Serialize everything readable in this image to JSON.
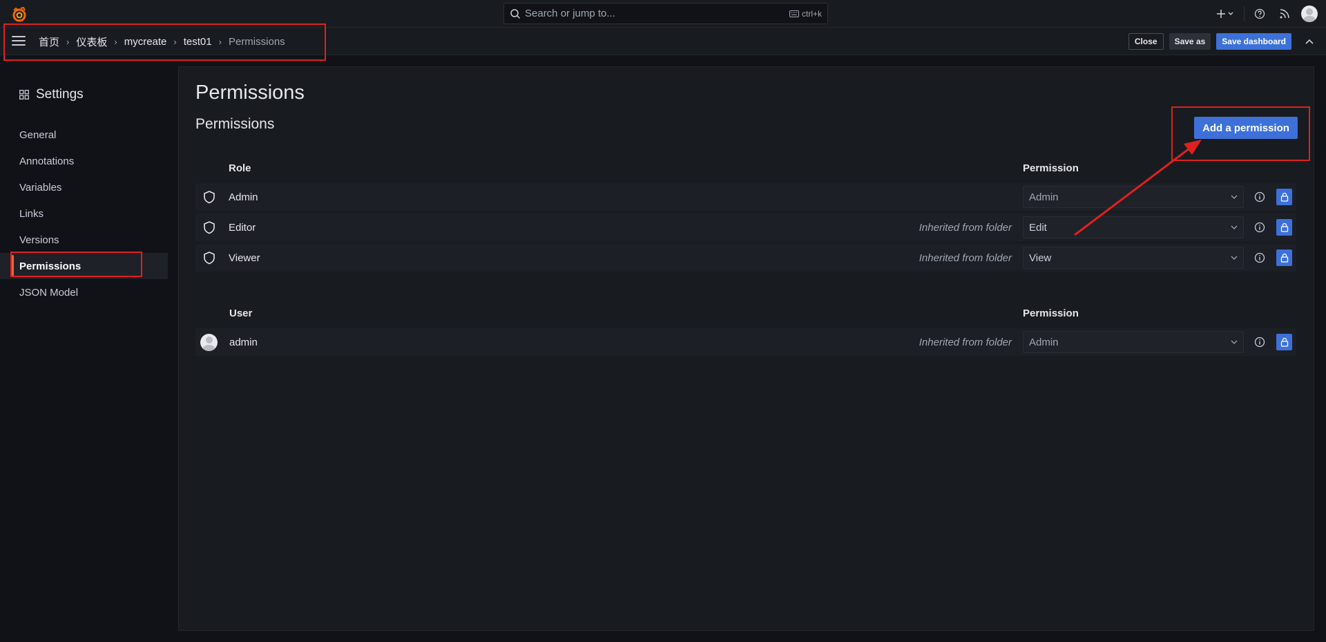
{
  "topbar": {
    "search_placeholder": "Search or jump to...",
    "search_shortcut": "ctrl+k"
  },
  "breadcrumb": [
    "首页",
    "仪表板",
    "mycreate",
    "test01",
    "Permissions"
  ],
  "actions": {
    "close": "Close",
    "save_as": "Save as",
    "save_dashboard": "Save dashboard"
  },
  "settings": {
    "title": "Settings",
    "nav": [
      {
        "label": "General",
        "active": false
      },
      {
        "label": "Annotations",
        "active": false
      },
      {
        "label": "Variables",
        "active": false
      },
      {
        "label": "Links",
        "active": false
      },
      {
        "label": "Versions",
        "active": false
      },
      {
        "label": "Permissions",
        "active": true
      },
      {
        "label": "JSON Model",
        "active": false
      }
    ]
  },
  "main": {
    "title": "Permissions",
    "subtitle": "Permissions",
    "add_button": "Add a permission",
    "roles_table": {
      "col_role": "Role",
      "col_permission": "Permission",
      "rows": [
        {
          "name": "Admin",
          "inherited": "",
          "permission": "Admin"
        },
        {
          "name": "Editor",
          "inherited": "Inherited from folder",
          "permission": "Edit"
        },
        {
          "name": "Viewer",
          "inherited": "Inherited from folder",
          "permission": "View"
        }
      ]
    },
    "users_table": {
      "col_user": "User",
      "col_permission": "Permission",
      "rows": [
        {
          "name": "admin",
          "inherited": "Inherited from folder",
          "permission": "Admin"
        }
      ]
    }
  },
  "colors": {
    "primary": "#3d71d9",
    "annotation": "#e02020",
    "active_indicator": "#f55f3e"
  }
}
